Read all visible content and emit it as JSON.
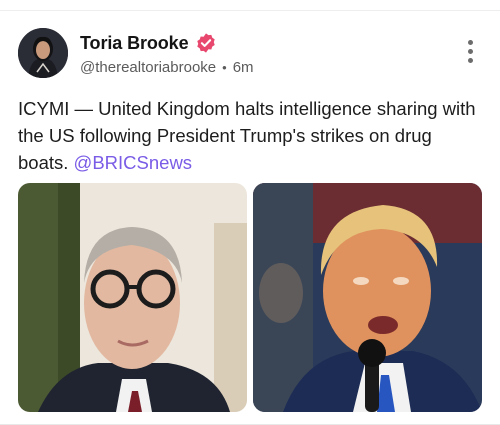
{
  "post": {
    "author": {
      "display_name": "Toria Brooke",
      "handle": "@therealtoriabrooke",
      "time_ago": "6m",
      "separator": "•",
      "verified": true,
      "verified_color": "#e8476e"
    },
    "text": "ICYMI — United Kingdom halts intelligence sharing with the US following President Trump's strikes on drug boats. ",
    "mention": "@BRICSnews",
    "mention_color": "#7a5ce6",
    "images": [
      {
        "icon": "portrait-photo"
      },
      {
        "icon": "portrait-photo"
      }
    ]
  }
}
